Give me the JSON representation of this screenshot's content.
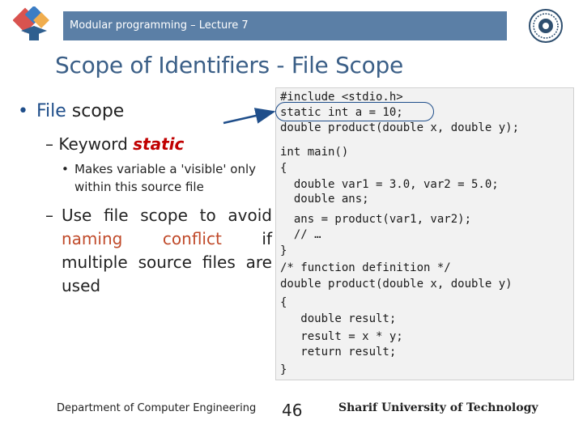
{
  "header": {
    "lecture": "Modular programming – Lecture 7"
  },
  "slide": {
    "title": "Scope of Identifiers - File Scope",
    "bullet1_prefix": "File",
    "bullet1_rest": " scope",
    "bullet2_prefix": "– Keyword ",
    "bullet2_keyword": "static",
    "bullet3": "Makes variable a 'visible' only within this source file",
    "bullet4_a": "Use file scope to avoid ",
    "bullet4_red": "naming conflict",
    "bullet4_b": " if multiple source files are used"
  },
  "code": {
    "lines": [
      "#include <stdio.h>",
      "static int a = 10;",
      "double product(double x, double y);",
      "int main()",
      "{",
      "  double var1 = 3.0, var2 = 5.0;",
      "  double ans;",
      "  ans = product(var1, var2);",
      "  // …",
      "}",
      "/* function definition */",
      "double product(double x, double y)",
      "{",
      "   double result;",
      "   result = x * y;",
      "   return result;",
      "}"
    ]
  },
  "footer": {
    "department": "Department of Computer Engineering",
    "page": "46",
    "university": "Sharif University of Technology"
  }
}
